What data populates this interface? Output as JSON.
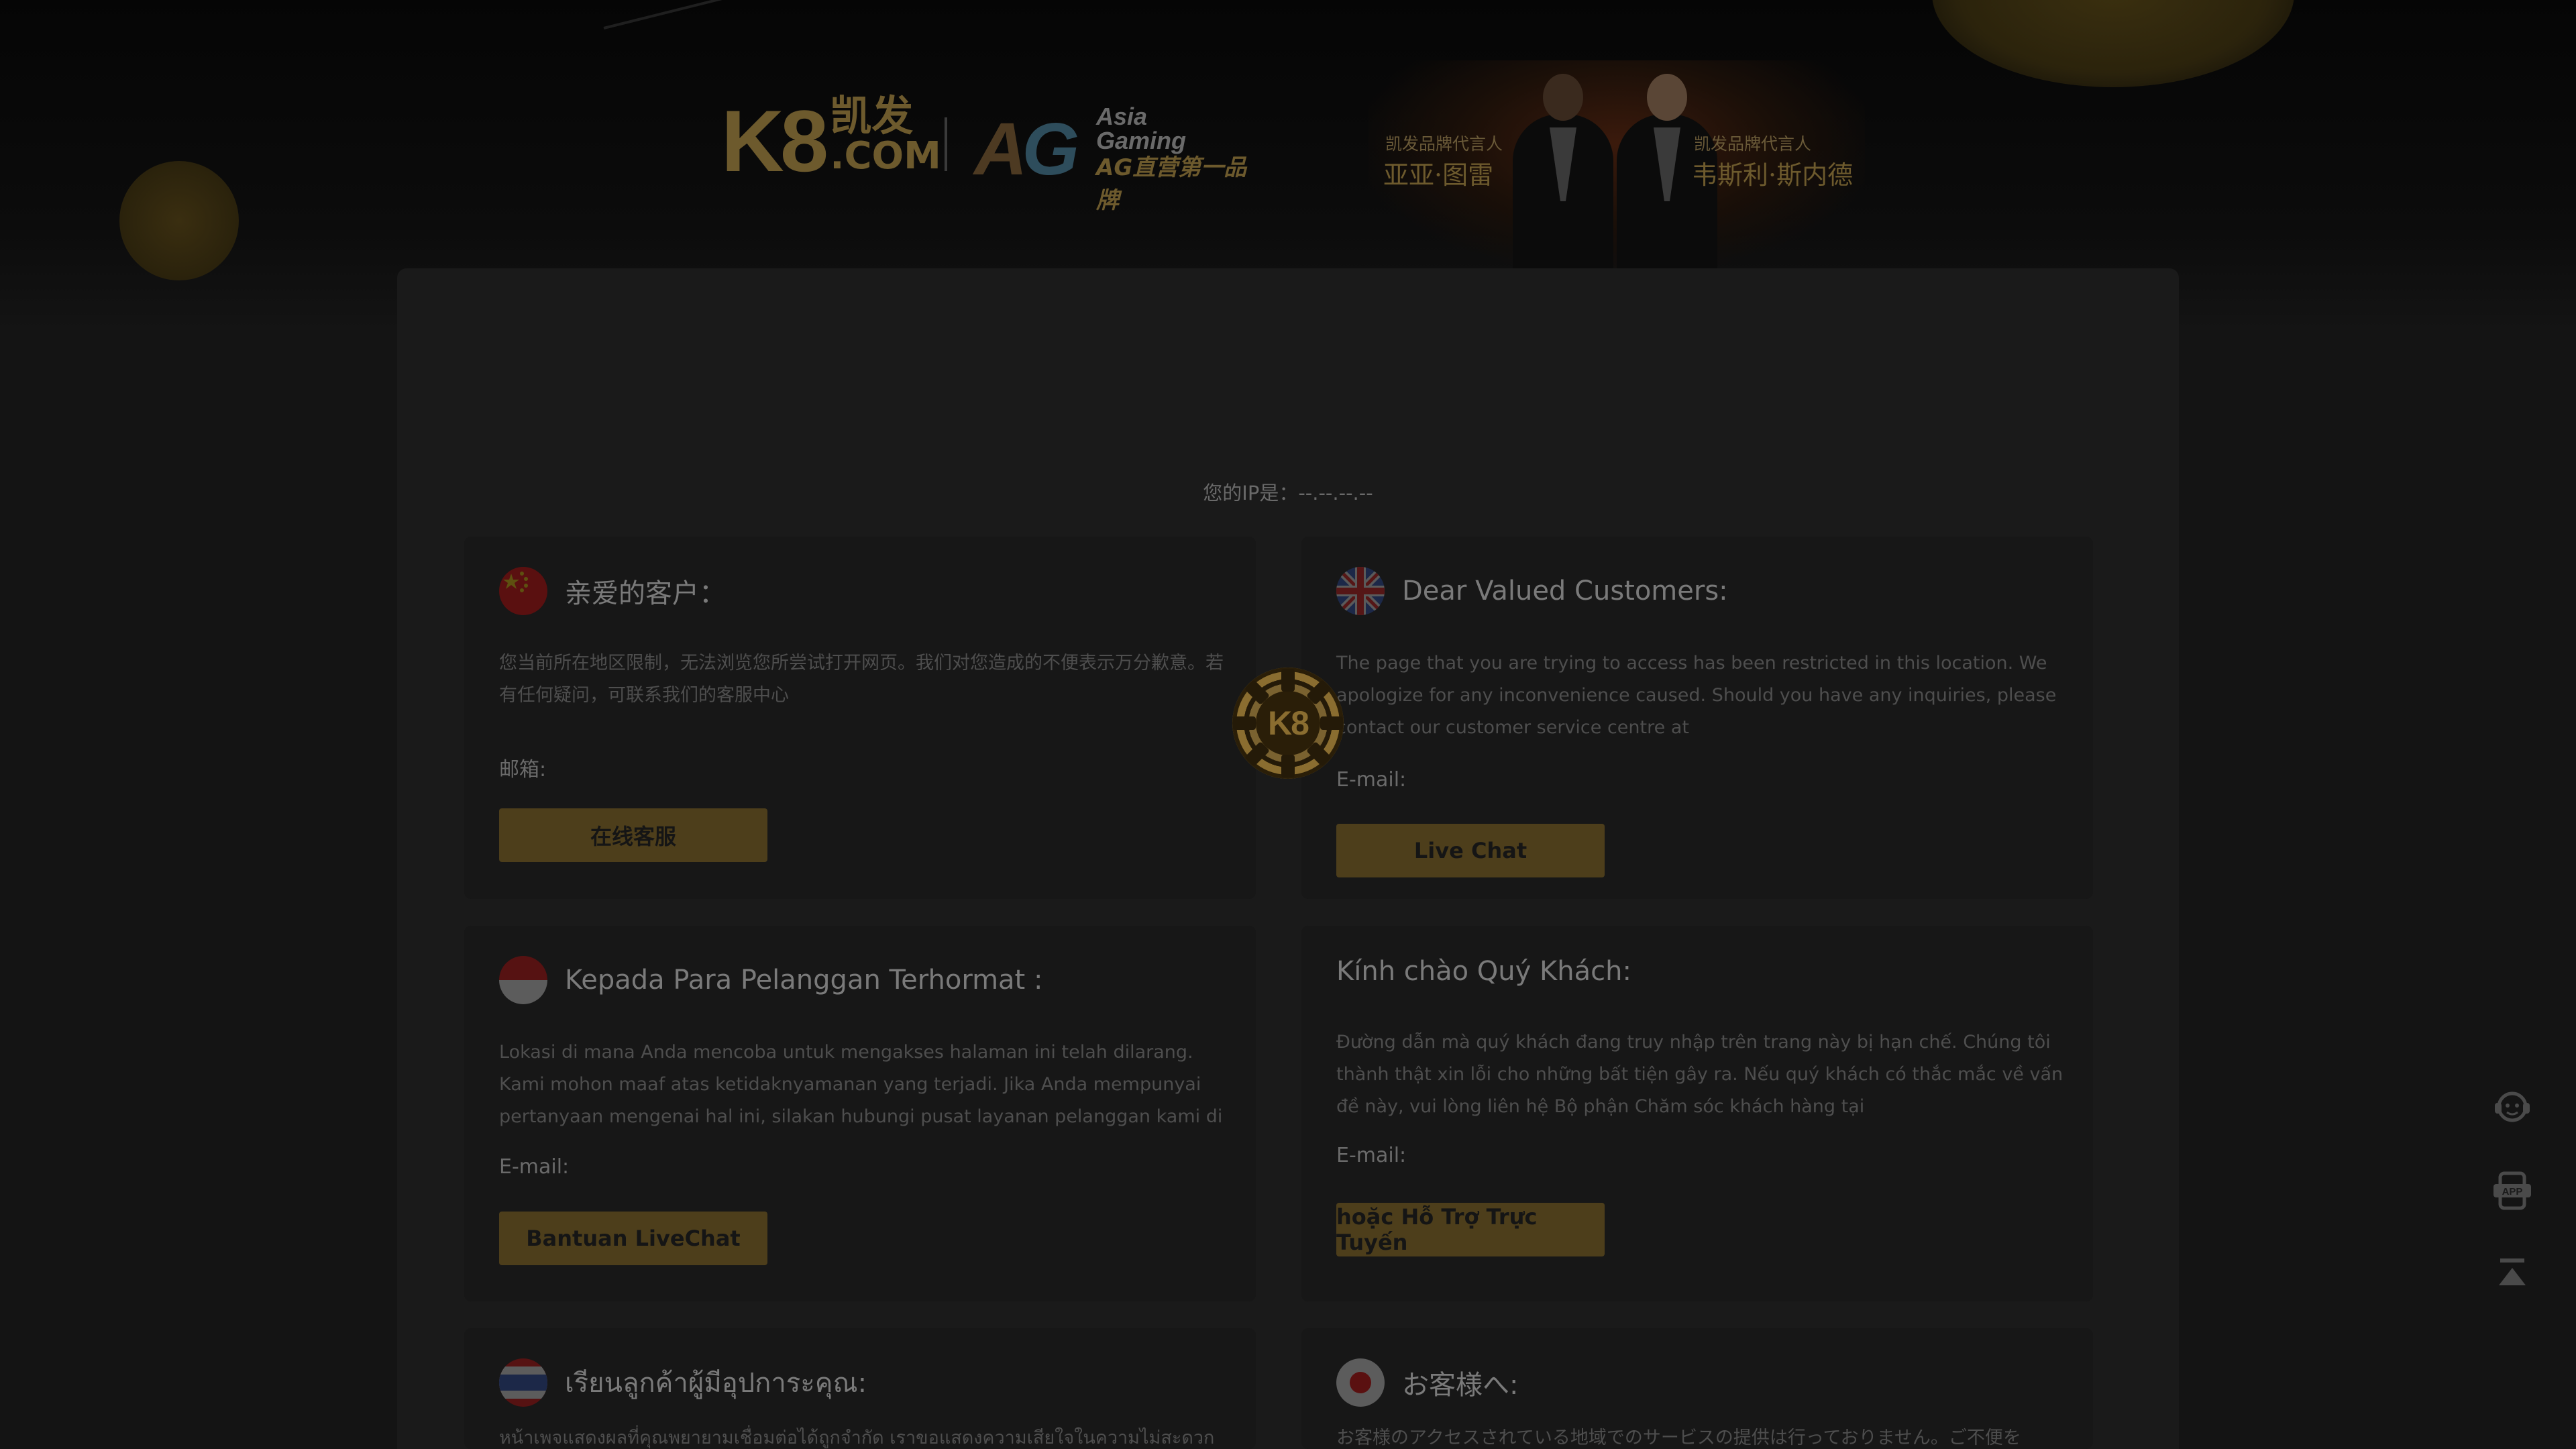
{
  "header": {
    "k8_logo": {
      "mark": "K8",
      "cn": "凯发",
      "com": ".COM"
    },
    "ag_logo": {
      "mark_a": "A",
      "mark_g": "G",
      "line1": "Asia",
      "line2": "Gaming",
      "slogan": "AG直营第一品牌"
    },
    "ambassadors": [
      {
        "label": "凯发品牌代言人",
        "name": "亚亚·图雷"
      },
      {
        "label": "凯发品牌代言人",
        "name": "韦斯利·斯内德"
      }
    ]
  },
  "ip": {
    "text": "您的IP是：--.--.--.--"
  },
  "loader": {
    "label": "K8"
  },
  "cards": [
    {
      "title": "亲爱的客户：",
      "body": "您当前所在地区限制，无法浏览您所尝试打开网页。我们对您造成的不便表示万分歉意。若有任何疑问，可联系我们的客服中心",
      "email_label": "邮箱:",
      "button": "在线客服"
    },
    {
      "title": "Dear Valued Customers:",
      "body": "The page that you are trying to access has been restricted in this location. We apologize for any inconvenience caused. Should you have any inquiries, please contact our customer service centre at",
      "email_label": "E-mail:",
      "button": "Live Chat"
    },
    {
      "title": "Kepada Para Pelanggan Terhormat :",
      "body": "Lokasi di mana Anda mencoba untuk mengakses halaman ini telah dilarang. Kami mohon maaf atas ketidaknyamanan yang terjadi. Jika Anda mempunyai pertanyaan mengenai hal ini, silakan hubungi pusat layanan pelanggan kami di",
      "email_label": "E-mail:",
      "button": "Bantuan LiveChat"
    },
    {
      "title": "Kính chào Quý Khách:",
      "body": "Đường dẫn mà quý khách đang truy nhập trên trang này bị hạn chế. Chúng tôi thành thật xin lỗi cho những bất tiện gây ra. Nếu quý khách có thắc mắc về vấn đề này, vui lòng liên hệ Bộ phận Chăm sóc khách hàng tại",
      "email_label": "E-mail:",
      "button": "hoặc Hỗ Trợ Trực Tuyến"
    },
    {
      "title": "เรียนลูกค้าผู้มีอุปการะคุณ:",
      "body": "หน้าเพจแสดงผลที่คุณพยายามเชื่อมต่อได้ถูกจำกัด เราขอแสดงความเสียใจในความไม่สะดวก"
    },
    {
      "title": "お客様へ:",
      "body": "お客様のアクセスされている地域でのサービスの提供は行っておりません。ご不便を"
    }
  ],
  "sidebar": {
    "icons": [
      "support-icon",
      "app-icon",
      "back-to-top-icon"
    ],
    "app_text": "APP"
  },
  "colors": {
    "accent": "#4d3e1b",
    "background": "#141414",
    "card": "#171717"
  }
}
